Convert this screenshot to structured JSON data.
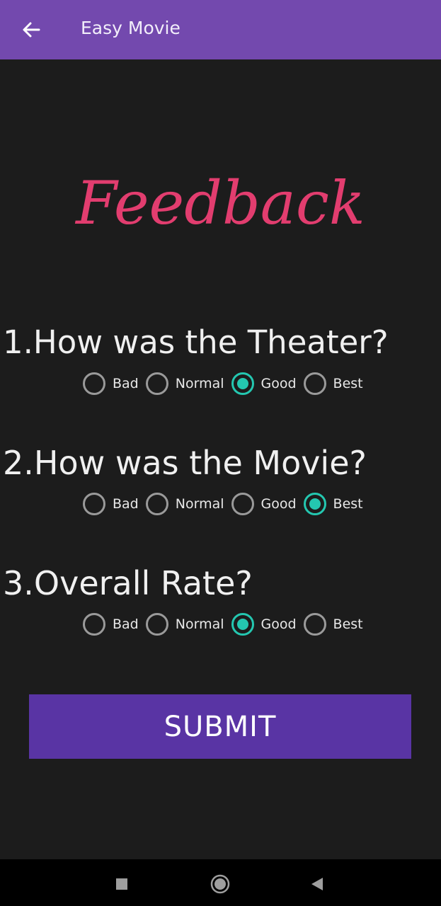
{
  "app_bar": {
    "title": "Easy Movie",
    "back_icon": "arrow-left-icon",
    "color": "#7349ae"
  },
  "heading": {
    "title": "Feedback",
    "color": "#e23d6f"
  },
  "questions": [
    {
      "text": "1.How was the Theater?",
      "options": [
        "Bad",
        "Normal",
        "Good",
        "Best"
      ],
      "selected": "Good"
    },
    {
      "text": "2.How was the Movie?",
      "options": [
        "Bad",
        "Normal",
        "Good",
        "Best"
      ],
      "selected": "Best"
    },
    {
      "text": "3.Overall Rate?",
      "options": [
        "Bad",
        "Normal",
        "Good",
        "Best"
      ],
      "selected": "Good"
    }
  ],
  "radio_checked_color": "#24c7b0",
  "submit": {
    "label": "SUBMIT",
    "color": "#5934a4"
  },
  "nav_bar": {
    "icons": [
      "recents-square-icon",
      "home-circle-icon",
      "back-triangle-icon"
    ]
  }
}
